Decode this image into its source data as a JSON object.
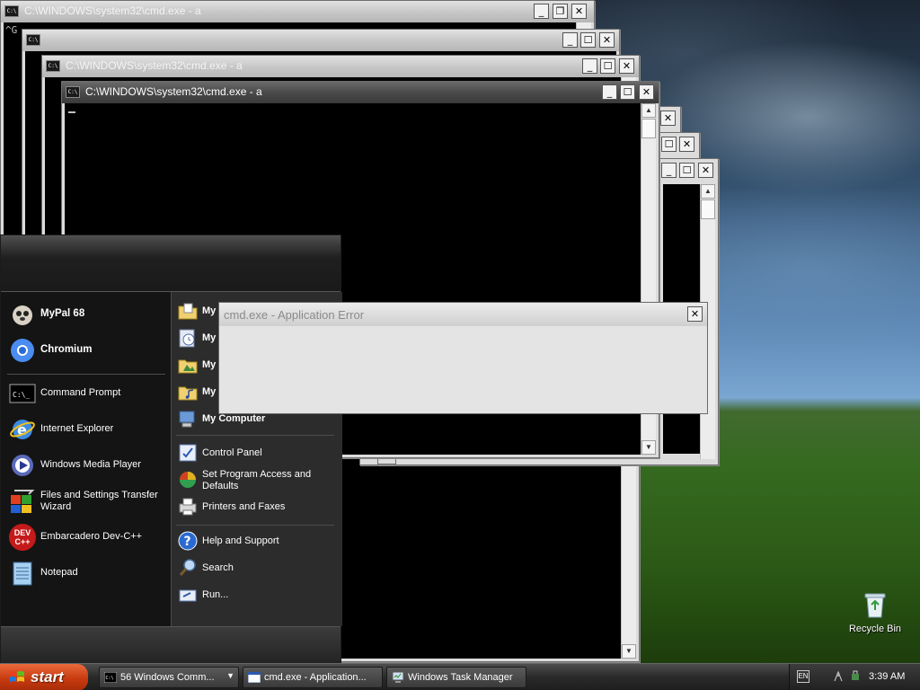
{
  "desktop": {
    "recycle_bin_label": "Recycle Bin"
  },
  "windows": {
    "w1": {
      "title": "C:\\WINDOWS\\system32\\cmd.exe - a",
      "text": "^G"
    },
    "w2": {
      "title": ""
    },
    "w3": {
      "title": "C:\\WINDOWS\\system32\\cmd.exe - a"
    },
    "w4": {
      "title": "C:\\WINDOWS\\system32\\cmd.exe - a"
    },
    "icon_text": "C:\\"
  },
  "start_menu": {
    "pinned": [
      {
        "label": "MyPal 68",
        "icon": "mypal-icon"
      },
      {
        "label": "Chromium",
        "icon": "chromium-icon"
      }
    ],
    "recent": [
      {
        "label": "Command Prompt",
        "icon": "command-prompt-icon"
      },
      {
        "label": "Internet Explorer",
        "icon": "internet-explorer-icon"
      },
      {
        "label": "Windows Media Player",
        "icon": "media-player-icon"
      },
      {
        "label": "Files and Settings Transfer Wizard",
        "icon": "transfer-wizard-icon"
      },
      {
        "label": "Embarcadero Dev-C++",
        "icon": "devcpp-icon"
      },
      {
        "label": "Notepad",
        "icon": "notepad-icon"
      }
    ],
    "right": [
      {
        "label": "My",
        "icon": "my-documents-icon"
      },
      {
        "label": "My",
        "icon": "my-recent-documents-icon"
      },
      {
        "label": "My",
        "icon": "my-pictures-icon"
      },
      {
        "label": "My",
        "icon": "my-music-icon"
      },
      {
        "label": "My Computer",
        "icon": "my-computer-icon"
      },
      {
        "label": "Control Panel",
        "icon": "control-panel-icon"
      },
      {
        "label": "Set Program Access and Defaults",
        "icon": "program-access-icon"
      },
      {
        "label": "Printers and Faxes",
        "icon": "printer-icon"
      },
      {
        "label": "Help and Support",
        "icon": "help-icon"
      },
      {
        "label": "Search",
        "icon": "search-icon"
      },
      {
        "label": "Run...",
        "icon": "run-icon"
      }
    ],
    "devcpp_badge": "DEV\nC++"
  },
  "dialog": {
    "title": "cmd.exe - Application Error"
  },
  "taskbar": {
    "start_label": "start",
    "buttons": [
      {
        "label": "56 Windows Comm...",
        "icon": "cmd-icon"
      },
      {
        "label": "cmd.exe - Application...",
        "icon": "window-icon"
      },
      {
        "label": "Windows Task Manager",
        "icon": "task-manager-icon"
      }
    ],
    "lang": "EN",
    "clock": "3:39 AM"
  },
  "colors": {
    "start_button": "#c83a10",
    "console_bg": "#000000",
    "active_titlebar": "#4a4a4a"
  }
}
